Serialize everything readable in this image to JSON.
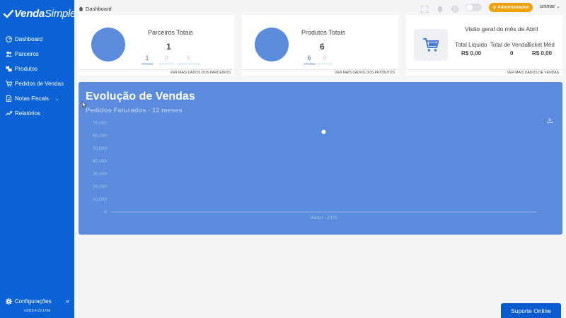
{
  "brand": {
    "part1": "Venda",
    "part2": "Simples"
  },
  "sidebar": {
    "items": [
      {
        "label": "Dashboard",
        "icon": "dashboard-icon"
      },
      {
        "label": "Parceiros",
        "icon": "users-icon"
      },
      {
        "label": "Produtos",
        "icon": "box-icon"
      },
      {
        "label": "Pedidos de Vendas",
        "icon": "cart-icon"
      },
      {
        "label": "Notas Fiscais",
        "icon": "document-icon",
        "chevron": "⌄"
      },
      {
        "label": "Relatórios",
        "icon": "trend-icon"
      }
    ],
    "config_label": "Configurações",
    "collapse": "«",
    "version": "v2025.4.23.1708"
  },
  "topbar": {
    "breadcrumb": "Dashboard",
    "role_badge": "Administrador",
    "user": "unimar",
    "user_chevron": "⌄"
  },
  "cards": {
    "parceiros": {
      "title": "Parceiros Totais",
      "value": "1",
      "stats": [
        {
          "value": "1",
          "label": "ATIVOS"
        },
        {
          "value": "0",
          "label": "INATIVOS"
        },
        {
          "value": "0",
          "label": "BLOQUEADOS"
        }
      ],
      "more": "VER MAIS DADOS DOS PARCEIROS"
    },
    "produtos": {
      "title": "Produtos Totais",
      "value": "6",
      "stats": [
        {
          "value": "6",
          "label": "ATIVOS"
        },
        {
          "value": "0",
          "label": "INATIVOS"
        }
      ],
      "more": "VER MAIS DADOS DOS PRODUTOS"
    },
    "vendas": {
      "title": "Visão geral do mês de Abril",
      "cols": [
        {
          "label": "Total Líquido",
          "value": "R$ 0,00"
        },
        {
          "label": "Total de Vendas",
          "value": "0"
        },
        {
          "label": "Ticket Méd",
          "value": "R$ 0,00"
        }
      ],
      "more": "VER MAIS DADOS DE VENDAS"
    }
  },
  "chart": {
    "title": "Evolução de Vendas",
    "subtitle": "Pedidos Faturados - 12 meses",
    "download_icon": "download-icon"
  },
  "chart_data": {
    "type": "line",
    "title": "Evolução de Vendas",
    "subtitle": "Pedidos Faturados - 12 meses",
    "categories": [
      "Março - 2025"
    ],
    "series": [
      {
        "values": [
          63000
        ]
      }
    ],
    "y_ticks": [
      "0",
      "10,000",
      "20,000",
      "30,000",
      "40,000",
      "50,000",
      "60,000",
      "70,000"
    ],
    "ylim": [
      0,
      70000
    ],
    "grid": false,
    "colors": {
      "background": "#5a8bdc",
      "point": "#ffffff",
      "tick": "#a9c4ee"
    }
  },
  "support": {
    "label": "Suporte Online"
  }
}
